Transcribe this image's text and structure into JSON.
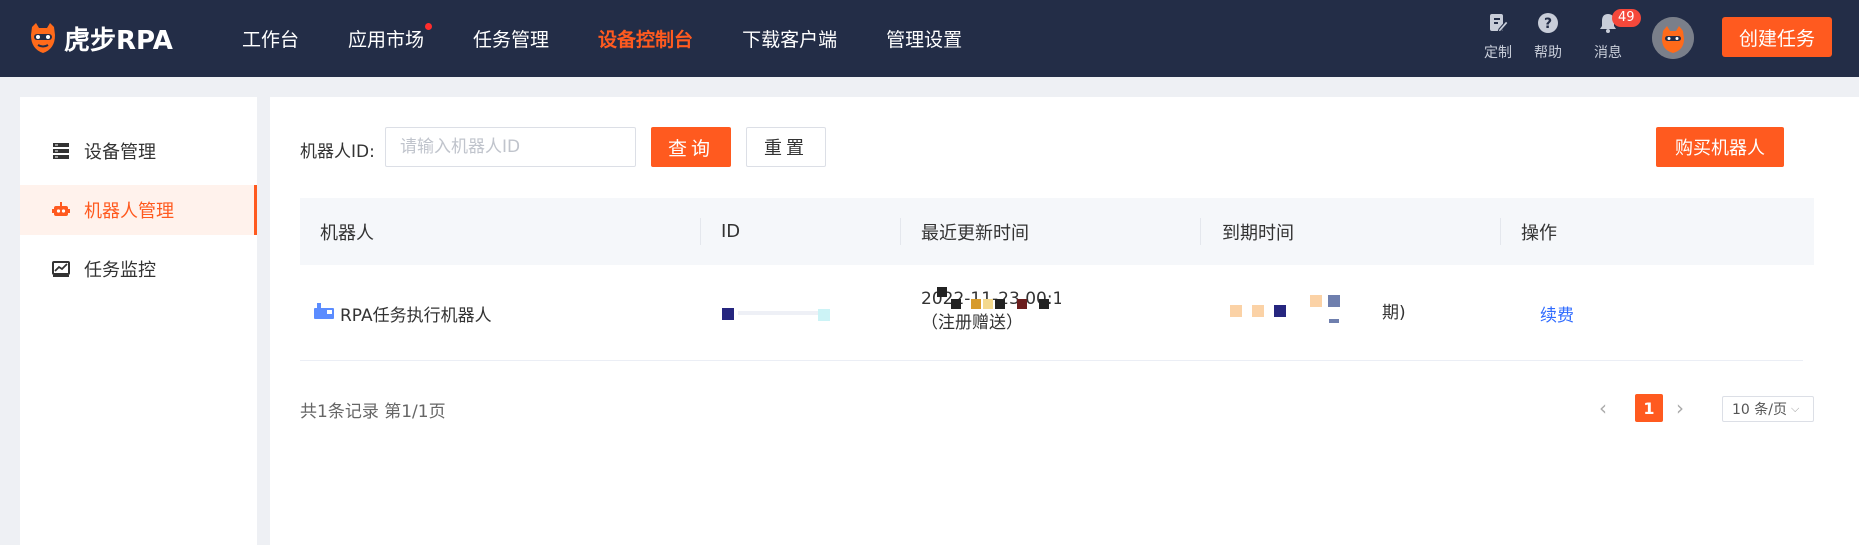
{
  "brand": {
    "logo_text": "虎步RPA"
  },
  "nav": {
    "items": [
      {
        "label": "工作台"
      },
      {
        "label": "应用市场"
      },
      {
        "label": "任务管理"
      },
      {
        "label": "设备控制台"
      },
      {
        "label": "下载客户端"
      },
      {
        "label": "管理设置"
      }
    ],
    "active_index": 3
  },
  "toolbar": {
    "customize_label": "定制",
    "help_label": "帮助",
    "messages_label": "消息",
    "messages_count": "49",
    "create_task_label": "创建任务"
  },
  "sidebar": {
    "items": [
      {
        "label": "设备管理",
        "icon": "server-icon"
      },
      {
        "label": "机器人管理",
        "icon": "robot-icon"
      },
      {
        "label": "任务监控",
        "icon": "chart-monitor-icon"
      }
    ],
    "active_index": 1
  },
  "filter": {
    "label": "机器人ID:",
    "placeholder": "请输入机器人ID",
    "value": "",
    "query_label": "查询",
    "reset_label": "重置",
    "buy_label": "购买机器人"
  },
  "table": {
    "columns": [
      "机器人",
      "ID",
      "最近更新时间",
      "到期时间",
      "操作"
    ],
    "rows": [
      {
        "robot": "RPA任务执行机器人",
        "id": "",
        "updated_line1": "2022-11-23 00:1",
        "updated_line2": "（注册赠送）",
        "expires_suffix": "期)",
        "action": "续费"
      }
    ]
  },
  "pagination": {
    "summary": "共1条记录 第1/1页",
    "current_page": "1",
    "page_size": "10 条/页"
  },
  "colors": {
    "accent": "#ff5a1f",
    "nav_bg": "#232d47",
    "link": "#2f6bff"
  }
}
